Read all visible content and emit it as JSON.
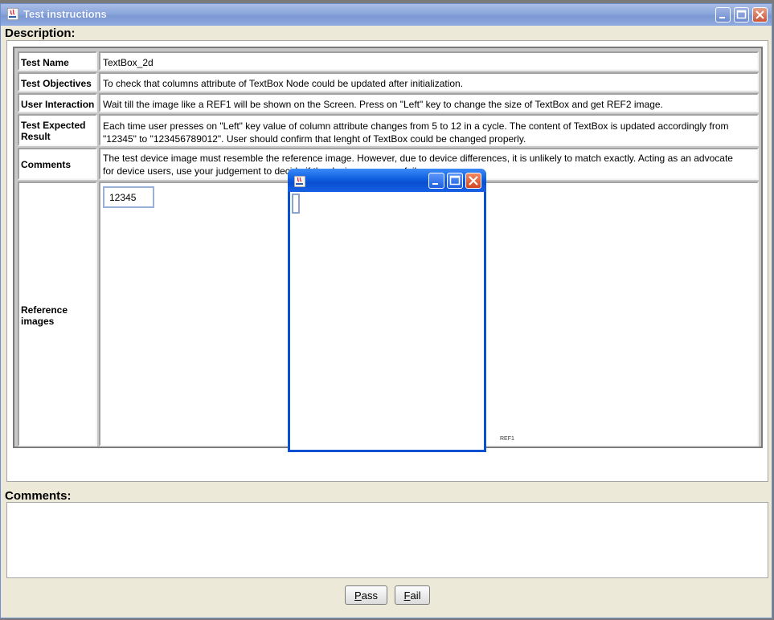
{
  "window": {
    "title": "Test instructions"
  },
  "description_label": "Description:",
  "rows": [
    {
      "header": "Test Name",
      "value": "TextBox_2d"
    },
    {
      "header": "Test Objectives",
      "value": "To check that columns attribute of TextBox Node could be updated after initialization."
    },
    {
      "header": "User Interaction",
      "value": "Wait till the image like a REF1 will be shown on the Screen. Press on \"Left\" key to change the size of TextBox and get REF2 image."
    },
    {
      "header_line1": "Test Expected",
      "header_line2": "Result",
      "value_line1": "Each time user presses on \"Left\" key value of column attribute changes from 5 to 12 in a cycle. The content of TextBox is updated accordingly from",
      "value_line2": "\"12345\" to \"123456789012\". User should confirm that lenght of TextBox could be changed properly."
    },
    {
      "header": "Comments",
      "value_line1": "The test device image must resemble the reference image. However, due to device differences, it is unlikely to match exactly. Acting as an advocate",
      "value_line2": "for device users, use your judgement to decide if the device passes or fails."
    },
    {
      "header_line1": "Reference",
      "header_line2": "images",
      "ref_text": "12345",
      "ref_tag": "REF1"
    }
  ],
  "comments_label": "Comments:",
  "buttons": {
    "pass_mnemonic": "P",
    "pass_rest": "ass",
    "fail_mnemonic": "F",
    "fail_rest": "ail"
  },
  "colors": {
    "title_bar": "#8aa6dc",
    "floating_title_bar": "#0f5ee0",
    "close_button": "#d4461f"
  }
}
